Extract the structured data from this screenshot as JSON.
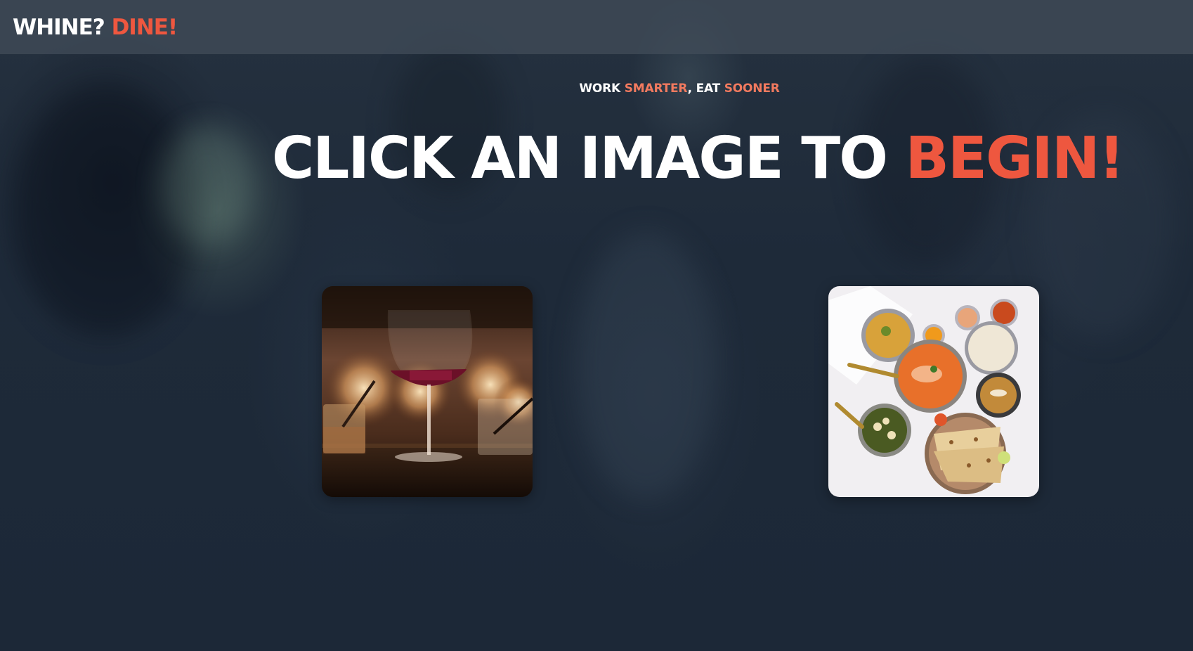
{
  "header": {
    "logo_part1": "WHINE?",
    "logo_part2": "DINE!"
  },
  "tagline": {
    "part1": "WORK ",
    "part2": "SMARTER",
    "part3": ", EAT ",
    "part4": "SOONER"
  },
  "headline": {
    "part1": "CLICK AN IMAGE TO ",
    "part2": "BEGIN!"
  },
  "cards": [
    {
      "name": "wine-image-card",
      "icon": "wine-glass-photo"
    },
    {
      "name": "food-image-card",
      "icon": "indian-food-spread-photo"
    }
  ],
  "colors": {
    "accent": "#ee573f",
    "accent_light": "#f27a5f",
    "text": "#ffffff",
    "background": "#1f2b3a",
    "header_bg": "#424e5a"
  }
}
